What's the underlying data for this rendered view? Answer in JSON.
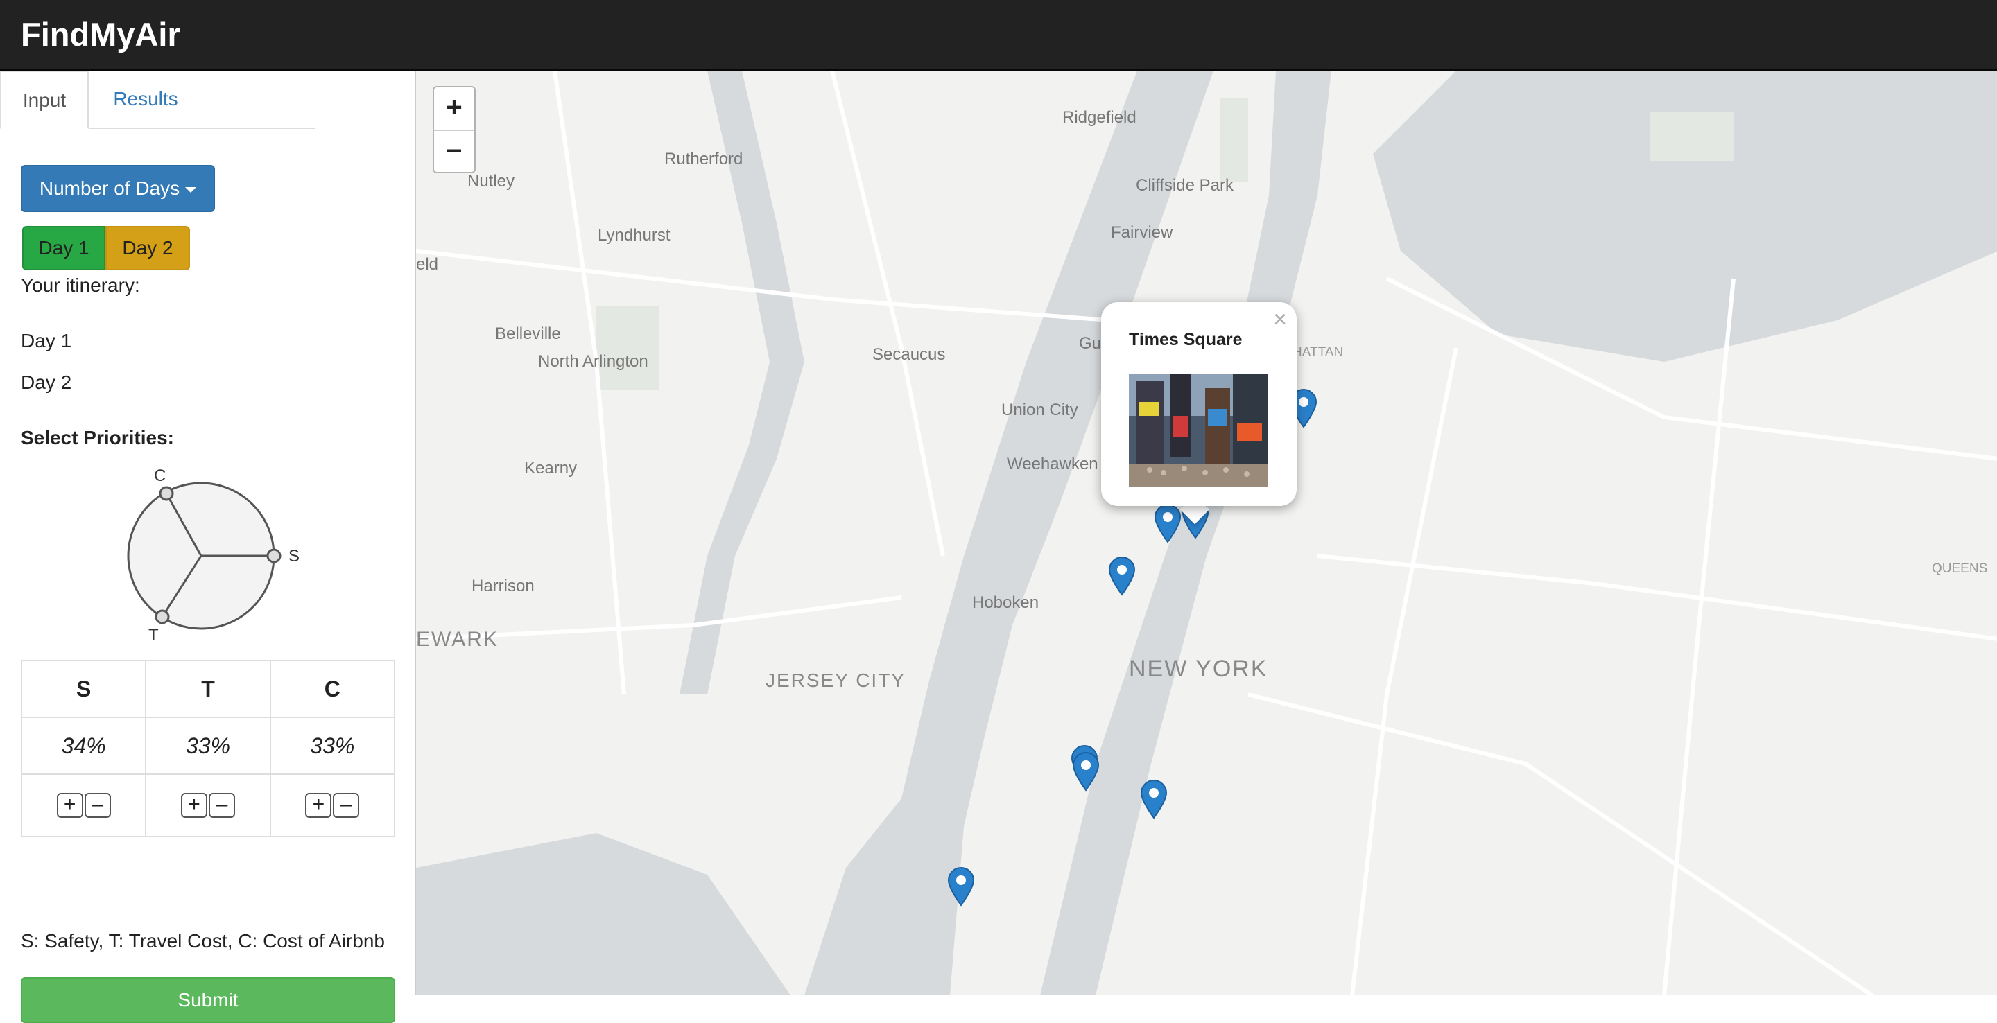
{
  "header": {
    "title": "FindMyAir"
  },
  "sidebar": {
    "tabs": [
      {
        "label": "Input",
        "active": true
      },
      {
        "label": "Results",
        "active": false
      }
    ],
    "days_dropdown": {
      "label": "Number of Days"
    },
    "day_buttons": [
      {
        "label": "Day 1",
        "color": "#28a745"
      },
      {
        "label": "Day 2",
        "color": "#d4a017"
      }
    ],
    "itinerary_label": "Your itinerary:",
    "itinerary_days": [
      "Day 1",
      "Day 2"
    ],
    "priorities_label": "Select Priorities:",
    "triangle_labels": {
      "c": "C",
      "s": "S",
      "t": "T"
    },
    "table": {
      "headers": [
        "S",
        "T",
        "C"
      ],
      "values": [
        "34%",
        "33%",
        "33%"
      ],
      "plus": "+",
      "minus": "–"
    },
    "legend": "S: Safety, T: Travel Cost, C: Cost of Airbnb",
    "submit_label": "Submit"
  },
  "map": {
    "zoom_in": "+",
    "zoom_out": "−",
    "places": {
      "ridgefield": "Ridgefield",
      "rutherford": "Rutherford",
      "nutley": "Nutley",
      "cliffside_park": "Cliffside Park",
      "lyndhurst": "Lyndhurst",
      "fairview": "Fairview",
      "field": "eld",
      "belleville": "Belleville",
      "north_arlington": "North Arlington",
      "secaucus": "Secaucus",
      "gu": "Gu",
      "hattan": "HATTAN",
      "union_city": "Union City",
      "kearny": "Kearny",
      "weehawken": "Weehawken",
      "harrison": "Harrison",
      "hoboken": "Hoboken",
      "queens": "QUEENS",
      "newark": "EWARK",
      "jersey_city": "JERSEY CITY",
      "new_york": "NEW YORK"
    },
    "popup": {
      "title": "Times Square",
      "close": "×"
    },
    "accent_color": "#2a81cb"
  }
}
